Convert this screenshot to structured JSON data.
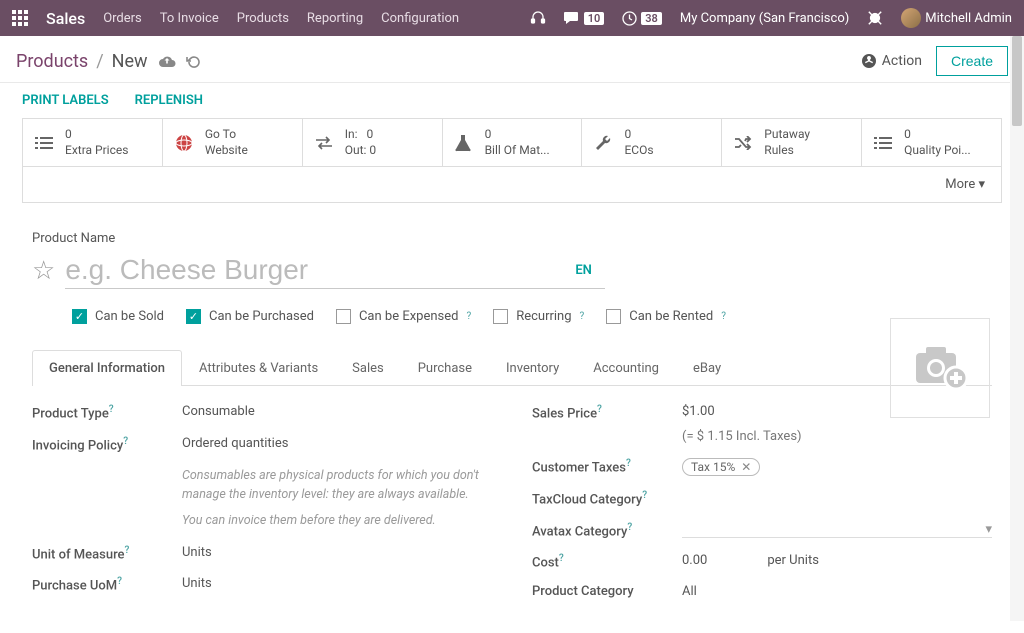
{
  "nav": {
    "brand": "Sales",
    "items": [
      "Orders",
      "To Invoice",
      "Products",
      "Reporting",
      "Configuration"
    ],
    "messages_count": "10",
    "activities_count": "38",
    "company": "My Company (San Francisco)",
    "user": "Mitchell Admin"
  },
  "breadcrumb": {
    "root": "Products",
    "current": "New"
  },
  "actions": {
    "action_label": "Action",
    "create_label": "Create"
  },
  "secondary_actions": {
    "print_labels": "PRINT LABELS",
    "replenish": "REPLENISH"
  },
  "stats": {
    "extra_prices": {
      "count": "0",
      "label": "Extra Prices"
    },
    "website": {
      "line1": "Go To",
      "line2": "Website"
    },
    "inout": {
      "in_label": "In:",
      "in": "0",
      "out_label": "Out:",
      "out": "0"
    },
    "bom": {
      "count": "0",
      "label": "Bill Of Mat..."
    },
    "ecos": {
      "count": "0",
      "label": "ECOs"
    },
    "putaway": {
      "line1": "Putaway",
      "line2": "Rules"
    },
    "quality": {
      "count": "0",
      "label": "Quality Poi..."
    }
  },
  "more_label": "More",
  "product": {
    "name_label": "Product Name",
    "name_placeholder": "e.g. Cheese Burger",
    "lang": "EN",
    "checks": {
      "sold": "Can be Sold",
      "purchased": "Can be Purchased",
      "expensed": "Can be Expensed",
      "recurring": "Recurring",
      "rented": "Can be Rented"
    }
  },
  "tabs": [
    "General Information",
    "Attributes & Variants",
    "Sales",
    "Purchase",
    "Inventory",
    "Accounting",
    "eBay"
  ],
  "general": {
    "product_type": {
      "label": "Product Type",
      "value": "Consumable"
    },
    "invoicing_policy": {
      "label": "Invoicing Policy",
      "value": "Ordered quantities"
    },
    "hint1": "Consumables are physical products for which you don't manage the inventory level: they are always available.",
    "hint2": "You can invoice them before they are delivered.",
    "uom": {
      "label": "Unit of Measure",
      "value": "Units"
    },
    "purchase_uom": {
      "label": "Purchase UoM",
      "value": "Units"
    },
    "sales_price": {
      "label": "Sales Price",
      "value": "$1.00",
      "incl": "(= $ 1.15 Incl. Taxes)"
    },
    "customer_taxes": {
      "label": "Customer Taxes",
      "value": "Tax 15%"
    },
    "taxcloud": {
      "label": "TaxCloud Category"
    },
    "avatax": {
      "label": "Avatax Category"
    },
    "cost": {
      "label": "Cost",
      "value": "0.00",
      "unit": "per Units"
    },
    "product_category": {
      "label": "Product Category",
      "value": "All"
    }
  }
}
